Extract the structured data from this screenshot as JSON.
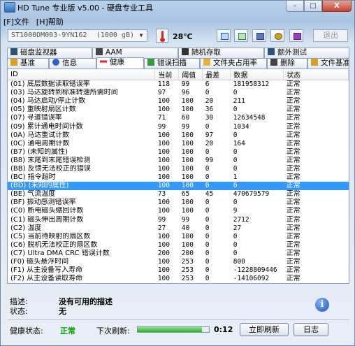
{
  "window": {
    "title": "HD Tune 专业版 v5.00 - 硬盘专业工具",
    "minimize": "–",
    "maximize": "□",
    "close": "X"
  },
  "menu": [
    "[F]文件",
    "[H]帮助"
  ],
  "toolbar": {
    "drive_name": "ST1000DM003-9YN162",
    "drive_capacity": "(1000 gB)",
    "temperature": "28℃",
    "exit_label": "退出"
  },
  "tabs_top": [
    "磁盘监视器",
    "AAM",
    "随机存取",
    "额外测试"
  ],
  "tabs_bottom": [
    "基准",
    "信息",
    "健康",
    "错误扫描",
    "文件夹占用率",
    "删除",
    "文件基准"
  ],
  "active_tab": "健康",
  "table": {
    "headers": [
      "ID",
      "当前",
      "阈值",
      "最差",
      "数据",
      "状态"
    ],
    "rows": [
      [
        "(01) 底层数据读取错误率",
        "118",
        "99",
        "6",
        "181958312",
        "正常"
      ],
      [
        "(03) 马达旋转到标准转速所需时间",
        "97",
        "96",
        "0",
        "0",
        "正常"
      ],
      [
        "(04) 马达启动/停止计数",
        "100",
        "100",
        "20",
        "211",
        "正常"
      ],
      [
        "(05) 重映射扇区计数",
        "100",
        "100",
        "36",
        "0",
        "正常"
      ],
      [
        "(07) 寻道错误率",
        "71",
        "60",
        "30",
        "12634548",
        "正常"
      ],
      [
        "(09) 累计通电时间计数",
        "99",
        "99",
        "0",
        "1034",
        "正常"
      ],
      [
        "(0A) 马达重试计数",
        "100",
        "100",
        "97",
        "0",
        "正常"
      ],
      [
        "(0C) 通电周期计数",
        "100",
        "100",
        "20",
        "164",
        "正常"
      ],
      [
        "(B7) (未知的属性)",
        "100",
        "100",
        "0",
        "0",
        "正常"
      ],
      [
        "(B8) 末尾到末尾错误检测",
        "100",
        "100",
        "99",
        "0",
        "正常"
      ],
      [
        "(BB) 反馈无法校正的错误",
        "100",
        "100",
        "0",
        "0",
        "正常"
      ],
      [
        "(BC) 指令超时",
        "100",
        "100",
        "0",
        "1",
        "正常"
      ],
      [
        "(BD) (未知的属性)",
        "100",
        "100",
        "0",
        "0",
        "正常"
      ],
      [
        "(BE) 气流温度",
        "73",
        "65",
        "45",
        "470679579",
        "正常"
      ],
      [
        "(BF) 振动感测错误率",
        "100",
        "100",
        "0",
        "0",
        "正常"
      ],
      [
        "(C0) 断电磁头缩回计数",
        "100",
        "100",
        "0",
        "9",
        "正常"
      ],
      [
        "(C1) 磁头伸出周期计数",
        "99",
        "99",
        "0",
        "2712",
        "正常"
      ],
      [
        "(C2) 温度",
        "27",
        "40",
        "0",
        "27",
        "正常"
      ],
      [
        "(C5) 当前待映射的扇区数",
        "100",
        "100",
        "0",
        "0",
        "正常"
      ],
      [
        "(C6) 脱机无法校正的扇区数",
        "100",
        "100",
        "0",
        "0",
        "正常"
      ],
      [
        "(C7) Ultra DMA CRC 错误计数",
        "200",
        "200",
        "0",
        "0",
        "正常"
      ],
      [
        "(F0) 磁头悬浮时间",
        "100",
        "253",
        "0",
        "800",
        "正常"
      ],
      [
        "(F1) 从主设备写入寿命",
        "100",
        "253",
        "0",
        "-1228809446",
        "正常"
      ],
      [
        "(F2) 从主设备读取寿命",
        "100",
        "253",
        "0",
        "-14106092",
        "正常"
      ]
    ],
    "selected_index": 12
  },
  "info": {
    "desc_label": "描述:",
    "desc_value": "没有可用的描述",
    "status_label": "状态:",
    "status_value": "无"
  },
  "bottom": {
    "health_label": "健康状态:",
    "health_value": "正常",
    "refresh_label": "下次刷新:",
    "refresh_fraction": 0.9,
    "refresh_time": "0:12",
    "refresh_now": "立即刷新",
    "log_label": "日志"
  },
  "colors": {
    "health_ok": "#00a000",
    "selection": "#3399ff"
  }
}
